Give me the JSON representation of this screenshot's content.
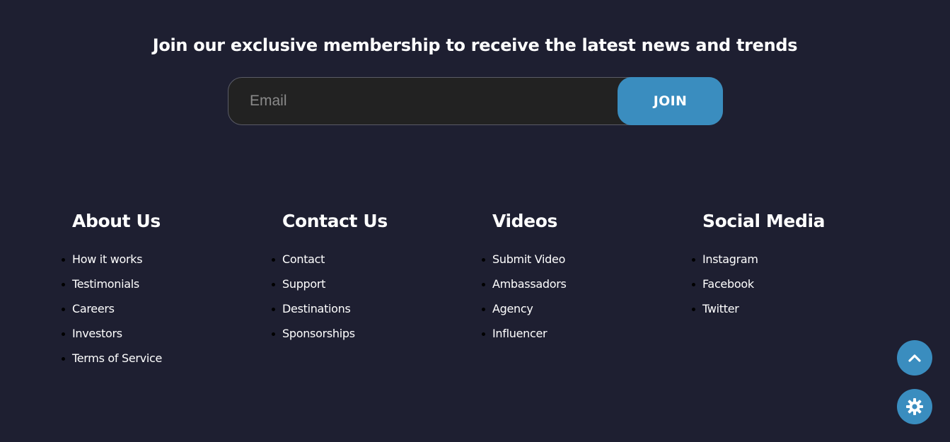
{
  "newsletter": {
    "title": "Join our exclusive membership to receive the latest news and trends",
    "email_placeholder": "Email",
    "email_value": "",
    "join_label": "JOIN"
  },
  "columns": [
    {
      "heading": "About Us",
      "links": [
        "How it works",
        "Testimonials",
        "Careers",
        "Investors",
        "Terms of Service"
      ]
    },
    {
      "heading": "Contact Us",
      "links": [
        "Contact",
        "Support",
        "Destinations",
        "Sponsorships"
      ]
    },
    {
      "heading": "Videos",
      "links": [
        "Submit Video",
        "Ambassadors",
        "Agency",
        "Influencer"
      ]
    },
    {
      "heading": "Social Media",
      "links": [
        "Instagram",
        "Facebook",
        "Twitter"
      ]
    }
  ],
  "floating_buttons": {
    "scroll_top_icon": "chevron-up-icon",
    "settings_icon": "gear-icon"
  },
  "colors": {
    "background": "#1e1f31",
    "accent": "#3a8dbf",
    "input_background": "#222222",
    "text": "#ffffff"
  }
}
